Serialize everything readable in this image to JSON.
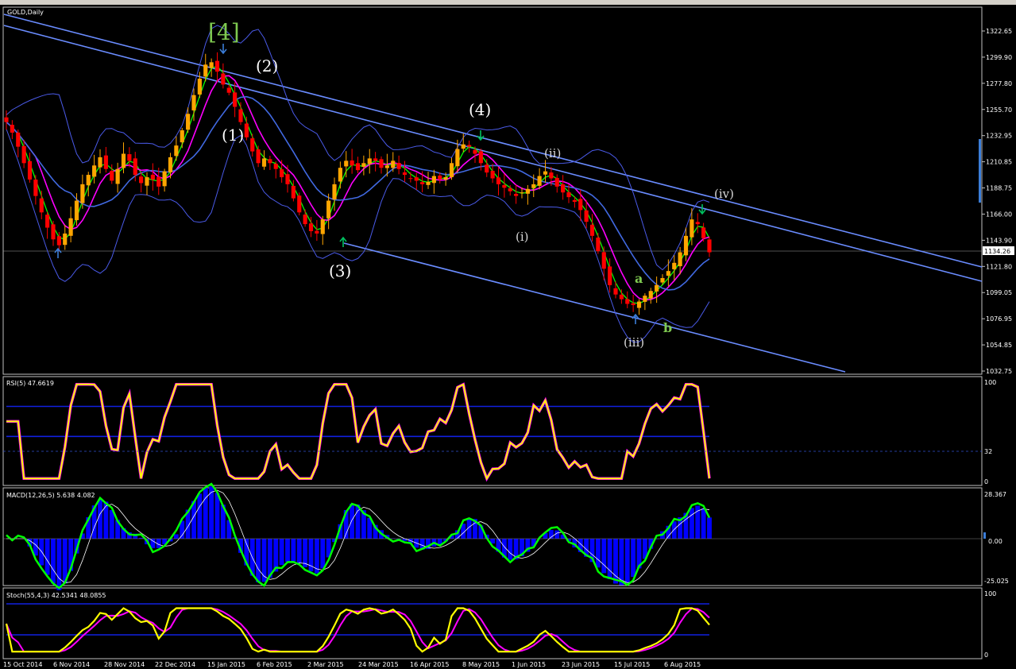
{
  "window": {
    "title": "GOLD,Daily"
  },
  "colors": {
    "background": "#000000",
    "frame": "#c0c0c0",
    "grid": "#404040",
    "bull_candle": "#ffa500",
    "bear_candle": "#ff0000",
    "channel_line": "#6a8cff",
    "bollinger": "#4a5ae8",
    "ma_fast": "#00ff00",
    "ma_mid": "#ff00ff",
    "ma_slow": "#4169e1",
    "rsi_main": "#ffff00",
    "rsi_glow": "#ff00ff",
    "macd_main": "#00ff00",
    "macd_hist": "#0000ff",
    "stoch_main": "#ffff00",
    "wave_green": "#7ec850",
    "marker": "#3b7dd8"
  },
  "price_panel": {
    "current_price_label": "1134.26",
    "y_ticks": [
      "1322.65",
      "1299.90",
      "1277.80",
      "1255.70",
      "1232.95",
      "1210.85",
      "1188.75",
      "1166.00",
      "1143.90",
      "1121.80",
      "1099.05",
      "1076.95",
      "1054.85",
      "1032.75"
    ]
  },
  "wave_labels": {
    "big4": "[4]",
    "w1": "(1)",
    "w2": "(2)",
    "w3": "(3)",
    "w4": "(4)",
    "wi": "(i)",
    "wii": "(ii)",
    "wiii": "(iii)",
    "wiv": "(iv)",
    "wa": "a",
    "wb": "b"
  },
  "rsi_panel": {
    "title": "RSI(5) 47.6619",
    "y_ticks": [
      "100",
      "32",
      "0"
    ]
  },
  "macd_panel": {
    "title": "MACD(12,26,5) 5.638 4.082",
    "y_ticks": [
      "28.367",
      "0.00",
      "-25.025"
    ]
  },
  "stoch_panel": {
    "title": "Stoch(55,4,3) 42.5341 48.0855",
    "y_ticks": [
      "100",
      "0"
    ]
  },
  "date_labels": [
    "15 Oct 2014",
    "6 Nov 2014",
    "28 Nov 2014",
    "22 Dec 2014",
    "15 Jan 2015",
    "6 Feb 2015",
    "2 Mar 2015",
    "24 Mar 2015",
    "16 Apr 2015",
    "8 May 2015",
    "1 Jun 2015",
    "23 Jun 2015",
    "15 Jul 2015",
    "6 Aug 2015"
  ],
  "chart_data": {
    "type": "line",
    "title": "GOLD,Daily",
    "ylim": [
      1032.75,
      1322.65
    ],
    "x": [
      "15 Oct 2014",
      "6 Nov 2014",
      "28 Nov 2014",
      "22 Dec 2014",
      "15 Jan 2015",
      "6 Feb 2015",
      "2 Mar 2015",
      "24 Mar 2015",
      "16 Apr 2015",
      "8 May 2015",
      "1 Jun 2015",
      "23 Jun 2015",
      "15 Jul 2015",
      "6 Aug 2015"
    ],
    "series": [
      {
        "values": [
          1240,
          1142,
          1210,
          1190,
          1280,
          1240,
          1205,
          1195,
          1200,
          1210,
          1185,
          1175,
          1103,
          1120
        ]
      }
    ],
    "close_path": [
      1245,
      1236,
      1224,
      1210,
      1196,
      1182,
      1168,
      1155,
      1145,
      1140,
      1150,
      1163,
      1178,
      1192,
      1200,
      1208,
      1215,
      1205,
      1195,
      1205,
      1218,
      1212,
      1200,
      1193,
      1198,
      1196,
      1190,
      1203,
      1215,
      1225,
      1238,
      1252,
      1268,
      1282,
      1294,
      1296,
      1288,
      1277,
      1270,
      1258,
      1245,
      1232,
      1220,
      1210,
      1214,
      1210,
      1205,
      1198,
      1192,
      1180,
      1168,
      1158,
      1152,
      1150,
      1162,
      1178,
      1192,
      1206,
      1212,
      1208,
      1204,
      1210,
      1214,
      1212,
      1206,
      1208,
      1212,
      1205,
      1200,
      1197,
      1195,
      1192,
      1194,
      1199,
      1196,
      1198,
      1210,
      1222,
      1226,
      1224,
      1218,
      1210,
      1202,
      1197,
      1192,
      1189,
      1186,
      1182,
      1185,
      1188,
      1192,
      1199,
      1203,
      1197,
      1190,
      1185,
      1181,
      1177,
      1170,
      1160,
      1148,
      1135,
      1120,
      1106,
      1098,
      1094,
      1090,
      1089,
      1092,
      1097,
      1101,
      1106,
      1112,
      1118,
      1125,
      1134,
      1148,
      1162,
      1158,
      1146,
      1134
    ]
  }
}
